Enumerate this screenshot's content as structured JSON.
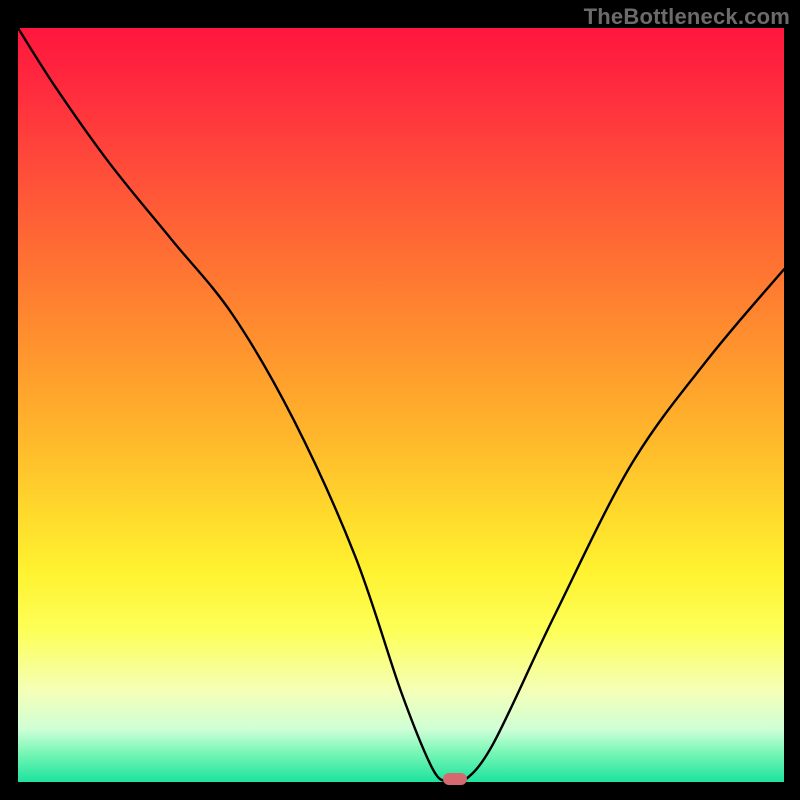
{
  "watermark": "TheBottleneck.com",
  "colors": {
    "page_bg": "#000000",
    "watermark_text": "#6b6b6b",
    "curve_stroke": "#000000",
    "marker_fill": "#d46a6f"
  },
  "chart_data": {
    "type": "line",
    "title": "",
    "xlabel": "",
    "ylabel": "",
    "xlim": [
      0,
      100
    ],
    "ylim": [
      0,
      100
    ],
    "grid": false,
    "legend": false,
    "axes_visible": false,
    "series": [
      {
        "name": "bottleneck-curve",
        "x": [
          0,
          5,
          12,
          20,
          28,
          36,
          44,
          50,
          54,
          56,
          58,
          62,
          70,
          80,
          90,
          100
        ],
        "y": [
          100,
          92,
          82,
          72,
          62,
          48,
          30,
          12,
          2,
          0,
          0,
          5,
          22,
          42,
          56,
          68
        ]
      }
    ],
    "marker": {
      "x": 57,
      "y": 0
    },
    "background_gradient_stops": [
      {
        "pos": 0,
        "color": "#ff163e"
      },
      {
        "pos": 0.3,
        "color": "#ff6e33"
      },
      {
        "pos": 0.6,
        "color": "#ffd82c"
      },
      {
        "pos": 0.85,
        "color": "#fdff58"
      },
      {
        "pos": 1.0,
        "color": "#1de39e"
      }
    ]
  }
}
